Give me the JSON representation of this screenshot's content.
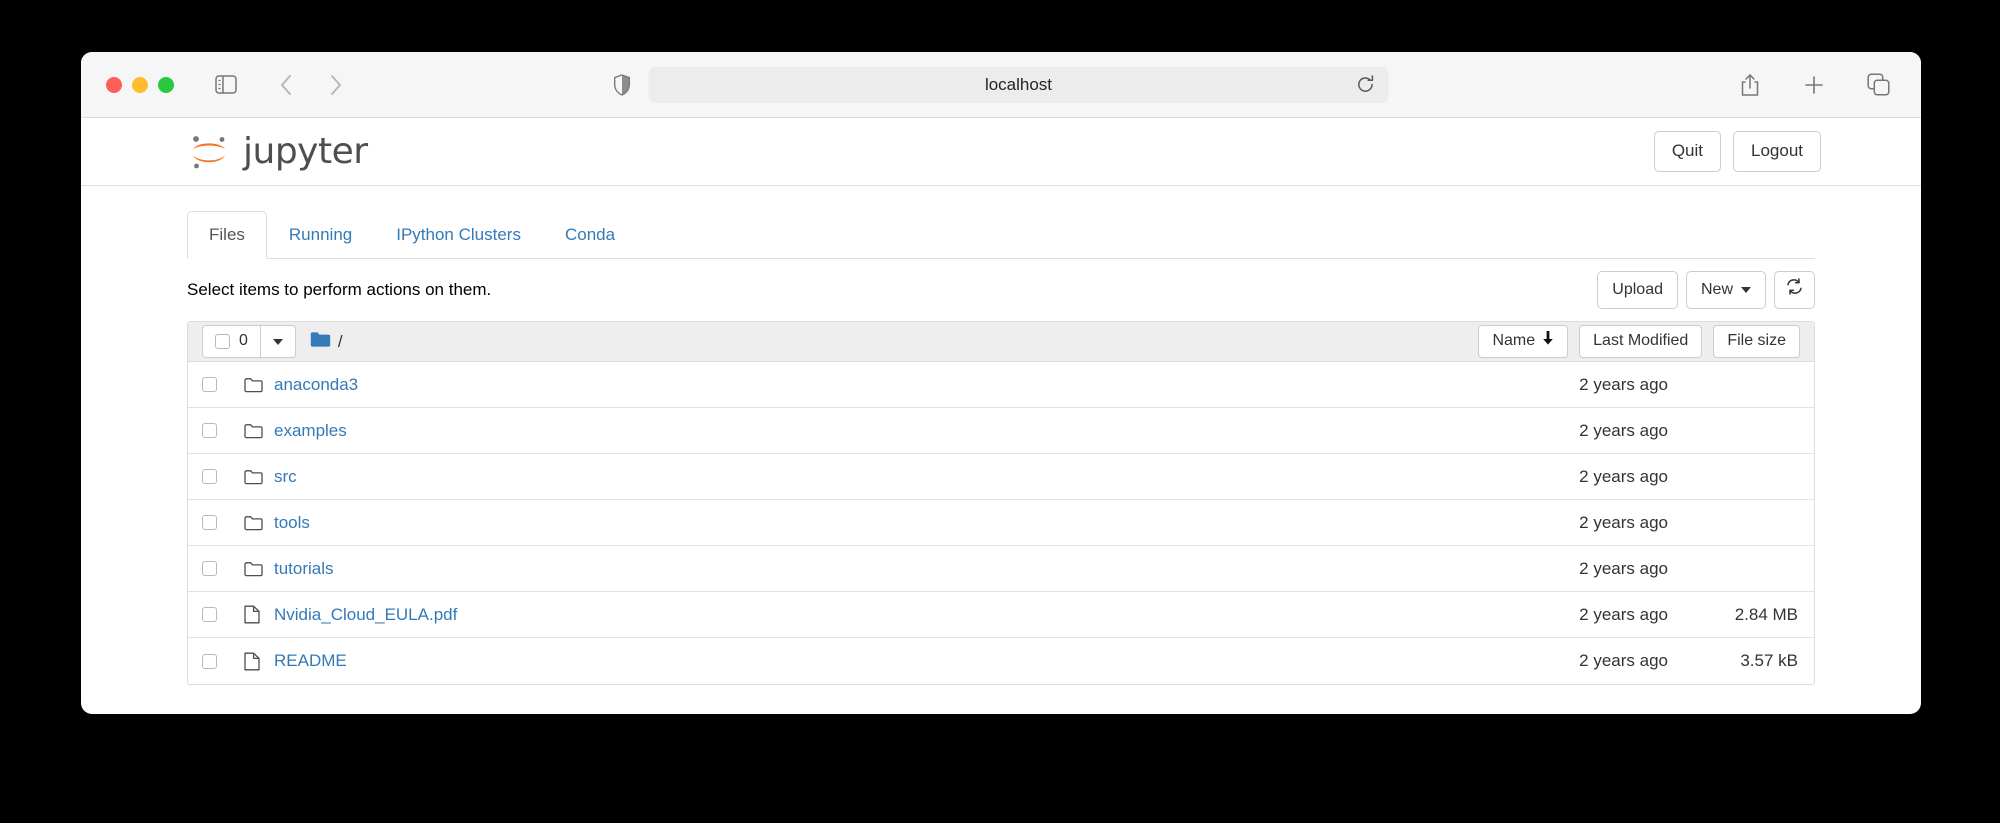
{
  "browser": {
    "url": "localhost",
    "icons": {
      "sidebar": "sidebar-toggle-icon",
      "back": "back-arrow-icon",
      "forward": "forward-arrow-icon",
      "shield": "shield-icon",
      "reload": "reload-icon",
      "share": "share-icon",
      "new_tab": "plus-icon",
      "tab_overview": "tab-overview-icon"
    }
  },
  "header": {
    "brand": "jupyter",
    "quit_label": "Quit",
    "logout_label": "Logout"
  },
  "tabs": [
    {
      "label": "Files",
      "active": true
    },
    {
      "label": "Running",
      "active": false
    },
    {
      "label": "IPython Clusters",
      "active": false
    },
    {
      "label": "Conda",
      "active": false
    }
  ],
  "toolbar": {
    "hint": "Select items to perform actions on them.",
    "upload_label": "Upload",
    "new_label": "New",
    "refresh_icon": "refresh-icon"
  },
  "list_header": {
    "selected_count": "0",
    "breadcrumb_root": "/",
    "folder_icon": "folder-icon",
    "sort_name": "Name",
    "sort_name_arrow": "↓",
    "sort_modified": "Last Modified",
    "sort_size": "File size"
  },
  "files": [
    {
      "name": "anaconda3",
      "type": "folder",
      "modified": "2 years ago",
      "size": ""
    },
    {
      "name": "examples",
      "type": "folder",
      "modified": "2 years ago",
      "size": ""
    },
    {
      "name": "src",
      "type": "folder",
      "modified": "2 years ago",
      "size": ""
    },
    {
      "name": "tools",
      "type": "folder",
      "modified": "2 years ago",
      "size": ""
    },
    {
      "name": "tutorials",
      "type": "folder",
      "modified": "2 years ago",
      "size": ""
    },
    {
      "name": "Nvidia_Cloud_EULA.pdf",
      "type": "file",
      "modified": "2 years ago",
      "size": "2.84 MB"
    },
    {
      "name": "README",
      "type": "file",
      "modified": "2 years ago",
      "size": "3.57 kB"
    }
  ],
  "colors": {
    "link": "#337ab7",
    "jupyter_orange": "#f37726",
    "folder_blue": "#337ab7",
    "traffic_red": "#ff5f57",
    "traffic_yellow": "#febc2e",
    "traffic_green": "#28c840"
  }
}
